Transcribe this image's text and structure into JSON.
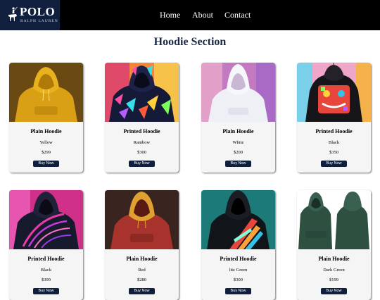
{
  "nav": {
    "logo_title": "POLO",
    "logo_subtitle": "RALPH LAUREN",
    "links": [
      "Home",
      "About",
      "Contact"
    ]
  },
  "section_title": "Hoodie Section",
  "products": [
    {
      "name": "Plain Hoodie",
      "color": "Yellow",
      "price": "$299",
      "button": "Buy Now"
    },
    {
      "name": "Printed Hoodie",
      "color": "Rainbow",
      "price": "$300",
      "button": "Buy Now"
    },
    {
      "name": "Plain Hoodie",
      "color": "White",
      "price": "$200",
      "button": "Buy Now"
    },
    {
      "name": "Printed Hoodie",
      "color": "Black",
      "price": "$350",
      "button": "Buy Now"
    },
    {
      "name": "Printed Hoodie",
      "color": "Black",
      "price": "$399",
      "button": "Buy Now"
    },
    {
      "name": "Plain Hoodie",
      "color": "Red",
      "price": "$280",
      "button": "Buy Now"
    },
    {
      "name": "Printed Hoodie",
      "color": "lite Green",
      "price": "$300",
      "button": "Buy Now"
    },
    {
      "name": "Plain Hoodie",
      "color": "Dark Green",
      "price": "$199",
      "button": "Buy Now"
    }
  ]
}
